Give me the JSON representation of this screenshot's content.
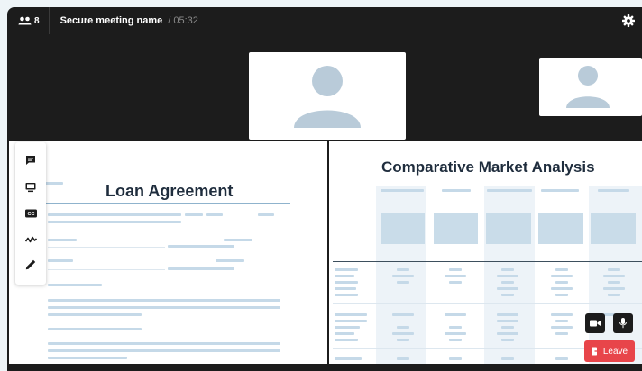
{
  "header": {
    "participant_count": "8",
    "meeting_name": "Secure meeting name",
    "timer": "/ 05:32"
  },
  "documents": {
    "left_title": "Loan Agreement",
    "right_title": "Comparative Market Analysis"
  },
  "controls": {
    "leave_label": "Leave"
  },
  "icons": {
    "participants": "people-icon",
    "settings": "gear-icon",
    "chat": "chat-icon",
    "screen": "screen-share-icon",
    "captions": "cc-icon",
    "activity": "activity-icon",
    "draw": "pen-icon",
    "camera": "camera-icon",
    "microphone": "microphone-icon",
    "leave": "exit-icon"
  },
  "colors": {
    "background": "#1c1c1c",
    "accent_leave": "#e8454a",
    "placeholder": "#c5d9e8",
    "avatar": "#b9cbd9"
  }
}
